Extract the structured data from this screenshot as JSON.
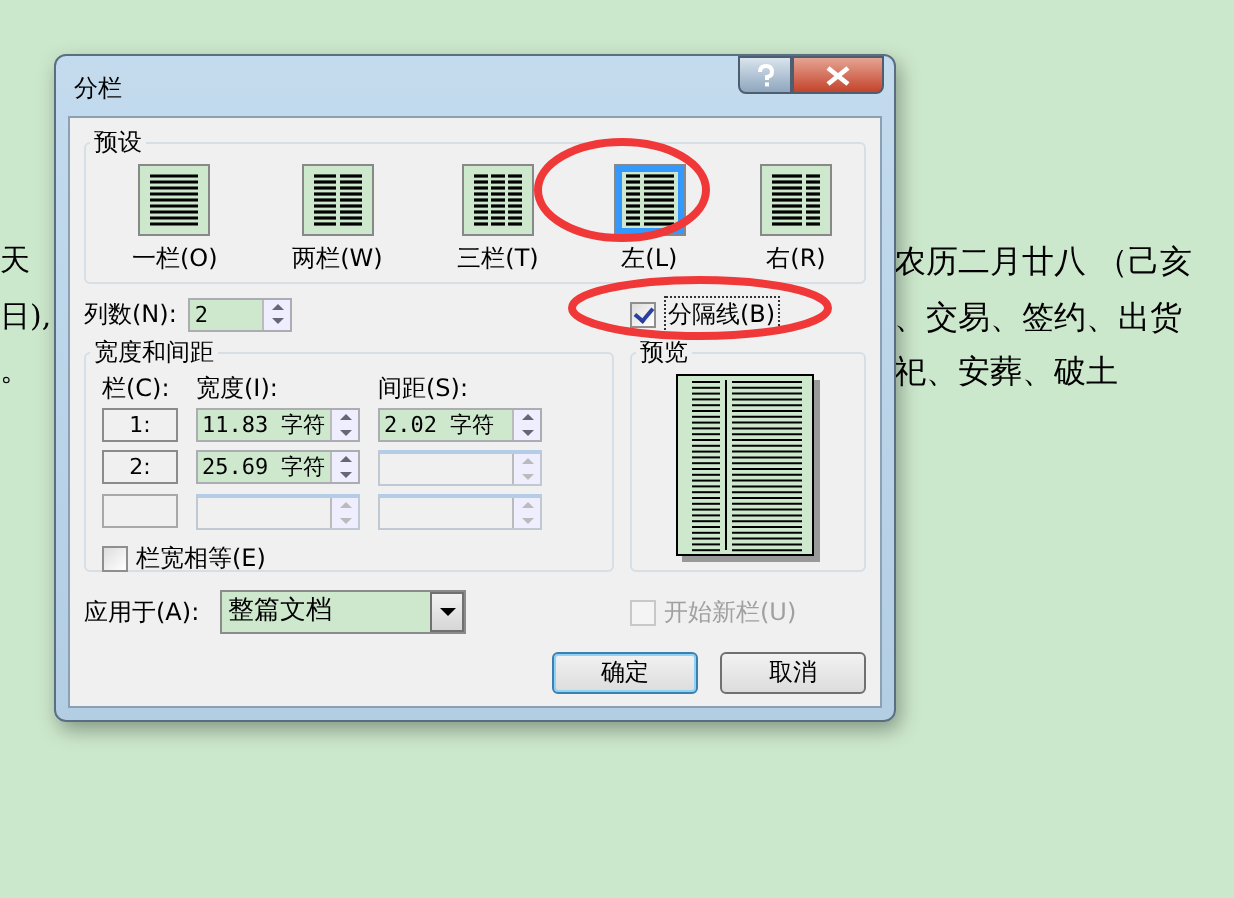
{
  "document_lines": [
    {
      "left": "天",
      "right": "农历二月廿八 （己亥"
    },
    {
      "left": "日),",
      "right": "、交易、签约、出货"
    },
    {
      "left": "。",
      "right": "祀、安葬、破土"
    }
  ],
  "dialog": {
    "title": "分栏",
    "presets": {
      "label": "预设",
      "items": [
        {
          "label": "一栏(O)",
          "kind": "one",
          "selected": false
        },
        {
          "label": "两栏(W)",
          "kind": "two",
          "selected": false
        },
        {
          "label": "三栏(T)",
          "kind": "three",
          "selected": false
        },
        {
          "label": "左(L)",
          "kind": "left",
          "selected": true
        },
        {
          "label": "右(R)",
          "kind": "right",
          "selected": false
        }
      ]
    },
    "column_count": {
      "label": "列数(N):",
      "value": "2"
    },
    "line_between": {
      "label": "分隔线(B)",
      "checked": true
    },
    "width_spacing": {
      "label": "宽度和间距",
      "headers": [
        "栏(C):",
        "宽度(I):",
        "间距(S):"
      ],
      "rows": [
        {
          "column": "1:",
          "width": "11.83 字符",
          "spacing": "2.02 字符"
        },
        {
          "column": "2:",
          "width": "25.69 字符"
        },
        {
          "enabled": false
        }
      ]
    },
    "equal_width": {
      "label": "栏宽相等(E)",
      "checked": false
    },
    "preview": {
      "label": "预览"
    },
    "apply_to": {
      "label": "应用于(A):",
      "value": "整篇文档"
    },
    "start_new_column": {
      "label": "开始新栏(U)",
      "checked": false,
      "disabled": true
    },
    "buttons": [
      {
        "label": "确定",
        "default": true
      },
      {
        "label": "取消",
        "default": false
      }
    ]
  }
}
